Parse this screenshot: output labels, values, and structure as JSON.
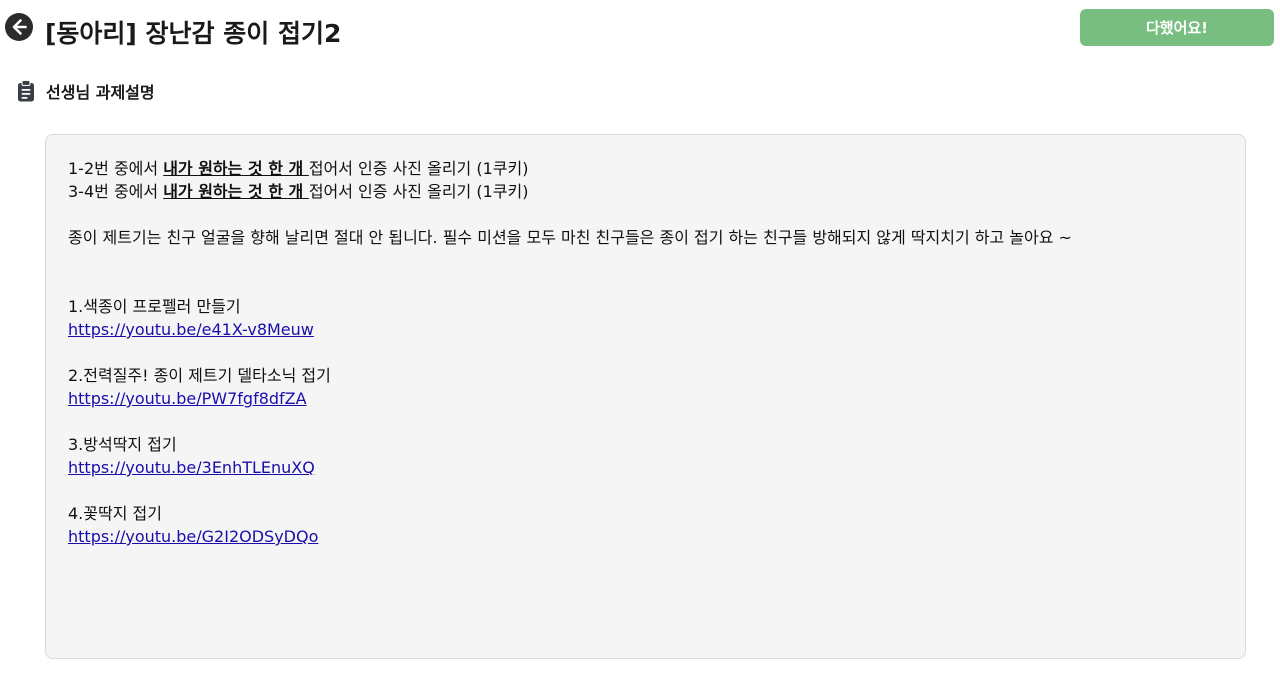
{
  "header": {
    "title": "[동아리] 장난감 종이 접기2",
    "back_icon": "arrow-left-circle-icon",
    "done_label": "다했어요!",
    "done_color": "#78be80"
  },
  "section": {
    "title": "선생님 과제설명",
    "icon": "clipboard-icon"
  },
  "description": {
    "rule1_prefix": "1-2번 중에서 ",
    "rule1_emph": "내가 원하는 것 한 개 ",
    "rule1_suffix": "접어서 인증 사진 올리기 (1쿠키)",
    "rule2_prefix": "3-4번 중에서 ",
    "rule2_emph": "내가 원하는 것 한 개 ",
    "rule2_suffix": "접어서 인증 사진 올리기 (1쿠키)",
    "notice": "종이 제트기는 친구 얼굴을 향해 날리면 절대 안 됩니다. 필수 미션을 모두 마친 친구들은 종이 접기 하는 친구들 방해되지 않게 딱지치기 하고 놀아요 ~",
    "items": [
      {
        "title": "1.색종이 프로펠러 만들기",
        "url": "https://youtu.be/e41X-v8Meuw"
      },
      {
        "title": "2.전력질주! 종이 제트기 델타소닉 접기",
        "url": "https://youtu.be/PW7fgf8dfZA"
      },
      {
        "title": "3.방석딱지 접기",
        "url": "https://youtu.be/3EnhTLEnuXQ"
      },
      {
        "title": "4.꽃딱지 접기",
        "url": "https://youtu.be/G2I2ODSyDQo"
      }
    ]
  }
}
